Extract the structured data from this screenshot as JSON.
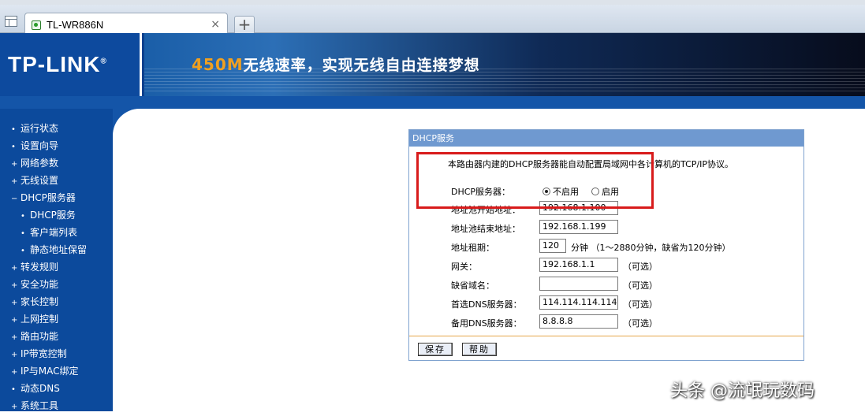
{
  "browser": {
    "tab_title": "TL-WR886N",
    "tab_close": "×",
    "new_tab": "+"
  },
  "header": {
    "logo": "TP-LINK",
    "logo_mark": "®",
    "slogan_num": "450M",
    "slogan_text": "无线速率，实现无线自由连接梦想"
  },
  "sidebar": {
    "items": [
      {
        "bullet": "•",
        "label": "运行状态"
      },
      {
        "bullet": "•",
        "label": "设置向导"
      },
      {
        "bullet": "+",
        "label": "网络参数"
      },
      {
        "bullet": "+",
        "label": "无线设置"
      },
      {
        "bullet": "−",
        "label": "DHCP服务器"
      },
      {
        "bullet": "•",
        "label": "DHCP服务",
        "sub": true
      },
      {
        "bullet": "•",
        "label": "客户端列表",
        "sub": true
      },
      {
        "bullet": "•",
        "label": "静态地址保留",
        "sub": true
      },
      {
        "bullet": "+",
        "label": "转发规则"
      },
      {
        "bullet": "+",
        "label": "安全功能"
      },
      {
        "bullet": "+",
        "label": "家长控制"
      },
      {
        "bullet": "+",
        "label": "上网控制"
      },
      {
        "bullet": "+",
        "label": "路由功能"
      },
      {
        "bullet": "+",
        "label": "IP带宽控制"
      },
      {
        "bullet": "+",
        "label": "IP与MAC绑定"
      },
      {
        "bullet": "•",
        "label": "动态DNS"
      },
      {
        "bullet": "+",
        "label": "系统工具"
      }
    ]
  },
  "panel": {
    "title": "DHCP服务",
    "intro": "本路由器内建的DHCP服务器能自动配置局域网中各计算机的TCP/IP协议。",
    "dhcp_label": "DHCP服务器：",
    "option_off": "不启用",
    "option_on": "启用",
    "start_label": "地址池开始地址：",
    "start_value": "192.168.1.100",
    "end_label": "地址池结束地址：",
    "end_value": "192.168.1.199",
    "lease_label": "地址租期：",
    "lease_value": "120",
    "lease_unit": "分钟 （1～2880分钟，缺省为120分钟）",
    "gateway_label": "网关：",
    "gateway_value": "192.168.1.1",
    "domain_label": "缺省域名：",
    "domain_value": "",
    "dns1_label": "首选DNS服务器：",
    "dns1_value": "114.114.114.114",
    "dns2_label": "备用DNS服务器：",
    "dns2_value": "8.8.8.8",
    "optional": "（可选）",
    "save_label": "保存",
    "help_label": "帮助"
  },
  "watermark": "头条 @流氓玩数码",
  "colors": {
    "sidebar": "#0c4a9c",
    "panel_title": "#6f99d0",
    "highlight": "#d81b1b"
  }
}
